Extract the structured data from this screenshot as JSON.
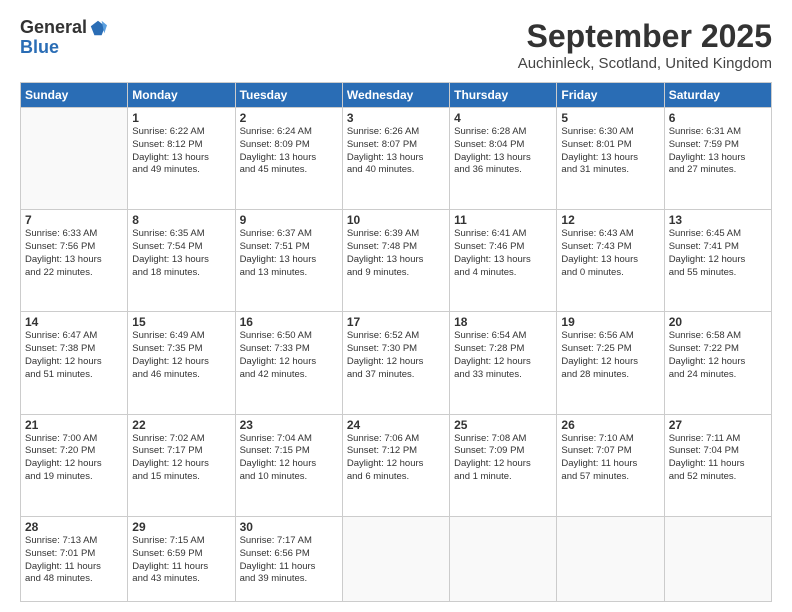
{
  "logo": {
    "general": "General",
    "blue": "Blue"
  },
  "title": "September 2025",
  "location": "Auchinleck, Scotland, United Kingdom",
  "days_header": [
    "Sunday",
    "Monday",
    "Tuesday",
    "Wednesday",
    "Thursday",
    "Friday",
    "Saturday"
  ],
  "weeks": [
    [
      {
        "num": "",
        "info": ""
      },
      {
        "num": "1",
        "info": "Sunrise: 6:22 AM\nSunset: 8:12 PM\nDaylight: 13 hours\nand 49 minutes."
      },
      {
        "num": "2",
        "info": "Sunrise: 6:24 AM\nSunset: 8:09 PM\nDaylight: 13 hours\nand 45 minutes."
      },
      {
        "num": "3",
        "info": "Sunrise: 6:26 AM\nSunset: 8:07 PM\nDaylight: 13 hours\nand 40 minutes."
      },
      {
        "num": "4",
        "info": "Sunrise: 6:28 AM\nSunset: 8:04 PM\nDaylight: 13 hours\nand 36 minutes."
      },
      {
        "num": "5",
        "info": "Sunrise: 6:30 AM\nSunset: 8:01 PM\nDaylight: 13 hours\nand 31 minutes."
      },
      {
        "num": "6",
        "info": "Sunrise: 6:31 AM\nSunset: 7:59 PM\nDaylight: 13 hours\nand 27 minutes."
      }
    ],
    [
      {
        "num": "7",
        "info": "Sunrise: 6:33 AM\nSunset: 7:56 PM\nDaylight: 13 hours\nand 22 minutes."
      },
      {
        "num": "8",
        "info": "Sunrise: 6:35 AM\nSunset: 7:54 PM\nDaylight: 13 hours\nand 18 minutes."
      },
      {
        "num": "9",
        "info": "Sunrise: 6:37 AM\nSunset: 7:51 PM\nDaylight: 13 hours\nand 13 minutes."
      },
      {
        "num": "10",
        "info": "Sunrise: 6:39 AM\nSunset: 7:48 PM\nDaylight: 13 hours\nand 9 minutes."
      },
      {
        "num": "11",
        "info": "Sunrise: 6:41 AM\nSunset: 7:46 PM\nDaylight: 13 hours\nand 4 minutes."
      },
      {
        "num": "12",
        "info": "Sunrise: 6:43 AM\nSunset: 7:43 PM\nDaylight: 13 hours\nand 0 minutes."
      },
      {
        "num": "13",
        "info": "Sunrise: 6:45 AM\nSunset: 7:41 PM\nDaylight: 12 hours\nand 55 minutes."
      }
    ],
    [
      {
        "num": "14",
        "info": "Sunrise: 6:47 AM\nSunset: 7:38 PM\nDaylight: 12 hours\nand 51 minutes."
      },
      {
        "num": "15",
        "info": "Sunrise: 6:49 AM\nSunset: 7:35 PM\nDaylight: 12 hours\nand 46 minutes."
      },
      {
        "num": "16",
        "info": "Sunrise: 6:50 AM\nSunset: 7:33 PM\nDaylight: 12 hours\nand 42 minutes."
      },
      {
        "num": "17",
        "info": "Sunrise: 6:52 AM\nSunset: 7:30 PM\nDaylight: 12 hours\nand 37 minutes."
      },
      {
        "num": "18",
        "info": "Sunrise: 6:54 AM\nSunset: 7:28 PM\nDaylight: 12 hours\nand 33 minutes."
      },
      {
        "num": "19",
        "info": "Sunrise: 6:56 AM\nSunset: 7:25 PM\nDaylight: 12 hours\nand 28 minutes."
      },
      {
        "num": "20",
        "info": "Sunrise: 6:58 AM\nSunset: 7:22 PM\nDaylight: 12 hours\nand 24 minutes."
      }
    ],
    [
      {
        "num": "21",
        "info": "Sunrise: 7:00 AM\nSunset: 7:20 PM\nDaylight: 12 hours\nand 19 minutes."
      },
      {
        "num": "22",
        "info": "Sunrise: 7:02 AM\nSunset: 7:17 PM\nDaylight: 12 hours\nand 15 minutes."
      },
      {
        "num": "23",
        "info": "Sunrise: 7:04 AM\nSunset: 7:15 PM\nDaylight: 12 hours\nand 10 minutes."
      },
      {
        "num": "24",
        "info": "Sunrise: 7:06 AM\nSunset: 7:12 PM\nDaylight: 12 hours\nand 6 minutes."
      },
      {
        "num": "25",
        "info": "Sunrise: 7:08 AM\nSunset: 7:09 PM\nDaylight: 12 hours\nand 1 minute."
      },
      {
        "num": "26",
        "info": "Sunrise: 7:10 AM\nSunset: 7:07 PM\nDaylight: 11 hours\nand 57 minutes."
      },
      {
        "num": "27",
        "info": "Sunrise: 7:11 AM\nSunset: 7:04 PM\nDaylight: 11 hours\nand 52 minutes."
      }
    ],
    [
      {
        "num": "28",
        "info": "Sunrise: 7:13 AM\nSunset: 7:01 PM\nDaylight: 11 hours\nand 48 minutes."
      },
      {
        "num": "29",
        "info": "Sunrise: 7:15 AM\nSunset: 6:59 PM\nDaylight: 11 hours\nand 43 minutes."
      },
      {
        "num": "30",
        "info": "Sunrise: 7:17 AM\nSunset: 6:56 PM\nDaylight: 11 hours\nand 39 minutes."
      },
      {
        "num": "",
        "info": ""
      },
      {
        "num": "",
        "info": ""
      },
      {
        "num": "",
        "info": ""
      },
      {
        "num": "",
        "info": ""
      }
    ]
  ]
}
